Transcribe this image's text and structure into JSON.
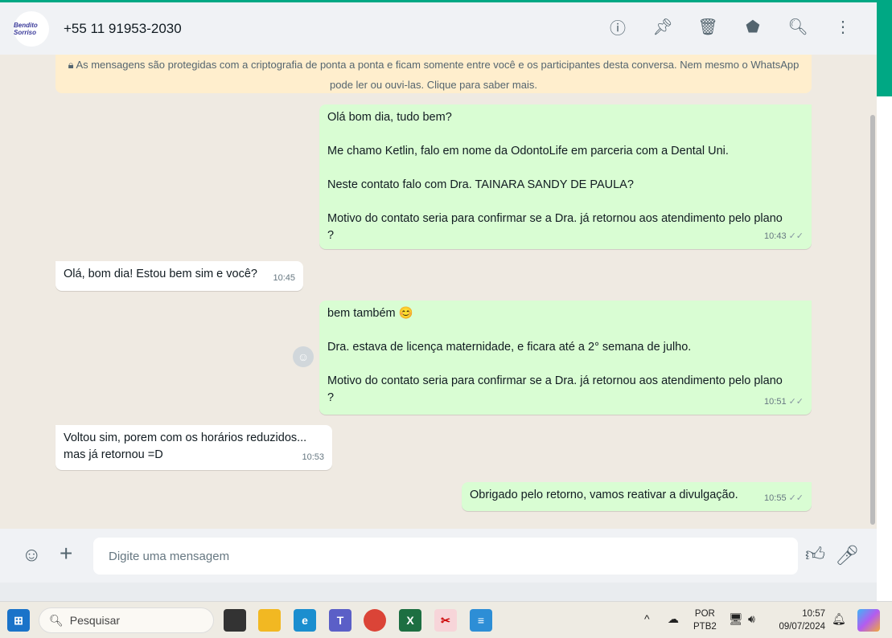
{
  "header": {
    "avatar_text": "Bendito Sorriso",
    "contact": "+55 11 91953-2030",
    "icons": [
      "info-icon",
      "pin-icon",
      "delete-icon",
      "label-icon",
      "search-icon",
      "more-icon"
    ]
  },
  "notice": "As mensagens são protegidas com a criptografia de ponta a ponta e ficam somente entre você e os participantes desta conversa. Nem mesmo o WhatsApp pode ler ou ouvi-las. Clique para saber mais.",
  "messages": [
    {
      "dir": "out",
      "lines": [
        "Olá bom dia, tudo bem?",
        "",
        "Me chamo Ketlin, falo em nome da OdontoLife em parceria com a Dental Uni.",
        "",
        "Neste contato falo com Dra. TAINARA SANDY DE PAULA?",
        "",
        "Motivo do contato seria para confirmar se a Dra. já retornou aos atendimento pelo plano ?"
      ],
      "time": "10:43"
    },
    {
      "dir": "in",
      "lines": [
        "Olá, bom dia! Estou bem sim e você?"
      ],
      "time": "10:45"
    },
    {
      "dir": "out",
      "lines": [
        "bem também 😊",
        "",
        "Dra. estava de licença maternidade, e ficara até a 2° semana de julho.",
        "",
        "Motivo do contato seria para confirmar se a Dra. já retornou aos atendimento pelo plano ?"
      ],
      "time": "10:51"
    },
    {
      "dir": "in",
      "lines": [
        "Voltou sim, porem com os horários reduzidos...",
        "mas já retornou =D"
      ],
      "time": "10:53"
    },
    {
      "dir": "out",
      "lines": [
        "Obrigado pelo retorno, vamos reativar a divulgação."
      ],
      "time": "10:55"
    }
  ],
  "composer": {
    "placeholder": "Digite uma mensagem"
  },
  "taskbar": {
    "search": "Pesquisar",
    "lang1": "POR",
    "lang2": "PTB2",
    "time": "10:57",
    "date": "09/07/2024"
  },
  "colors": {
    "accent": "#00a884",
    "outgoing": "#d9fdd3",
    "incoming": "#ffffff",
    "notice": "#ffeecd"
  }
}
